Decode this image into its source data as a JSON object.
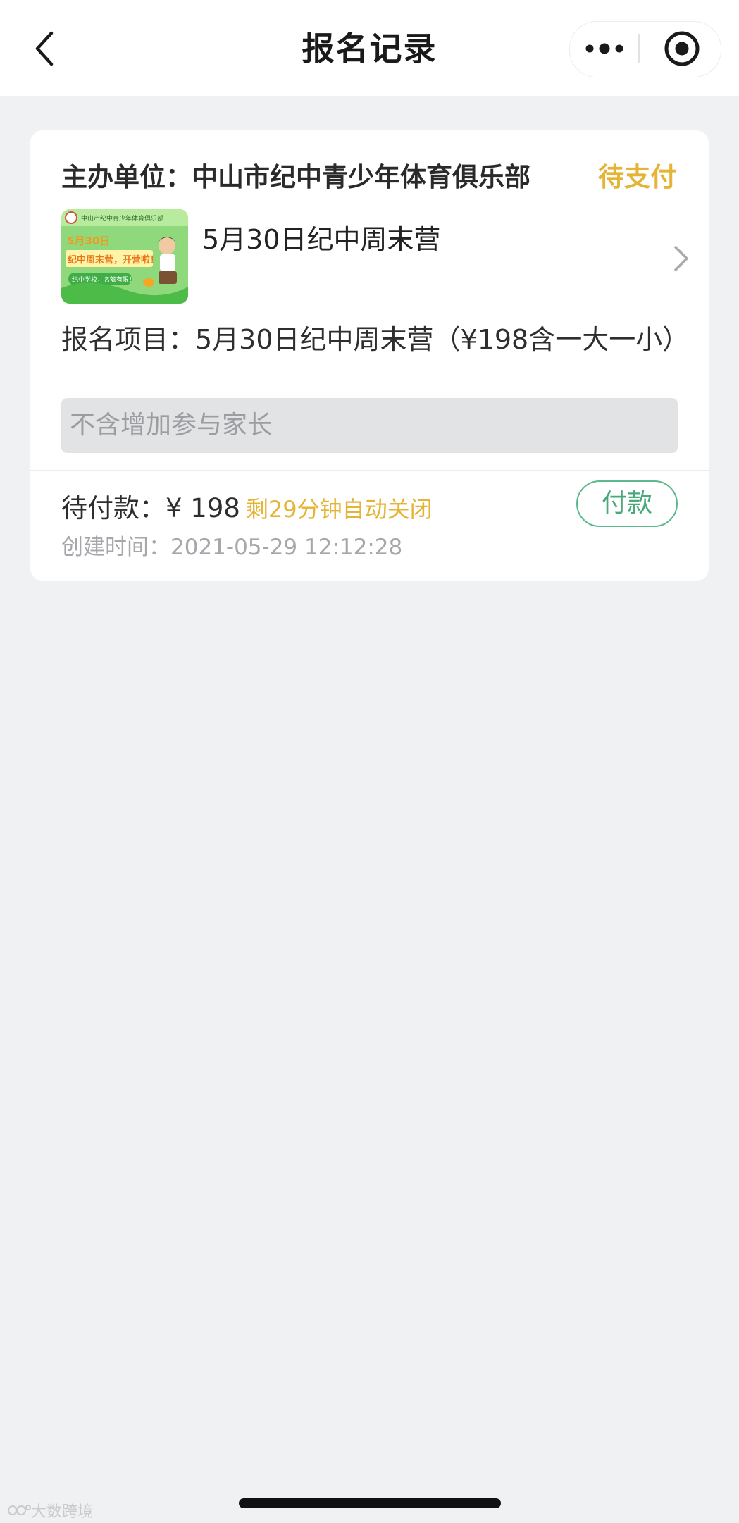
{
  "navbar": {
    "title": "报名记录"
  },
  "card": {
    "organizer": "主办单位：中山市纪中青少年体育俱乐部",
    "status": "待支付",
    "event_name": "5月30日纪中周末营",
    "project": "报名项目：5月30日纪中周末营（¥198含一大一小）",
    "note": "不含增加参与家长",
    "pay_label": "待付款：",
    "pay_amount": "¥ 198",
    "countdown": "剩29分钟自动关闭",
    "created": "创建时间：2021-05-29 12:12:28",
    "pay_button": "付款",
    "thumbnail": {
      "header": "中山市纪中青少年体育俱乐部",
      "line1": "5月30日",
      "line2": "纪中周末营，开营啦！",
      "tag": "纪中学校，名额有限！"
    }
  },
  "watermark": "大数跨境",
  "colors": {
    "status": "#e4b436",
    "countdown": "#e4b436",
    "pay_button": "#4aa97b",
    "background": "#f0f1f3"
  }
}
